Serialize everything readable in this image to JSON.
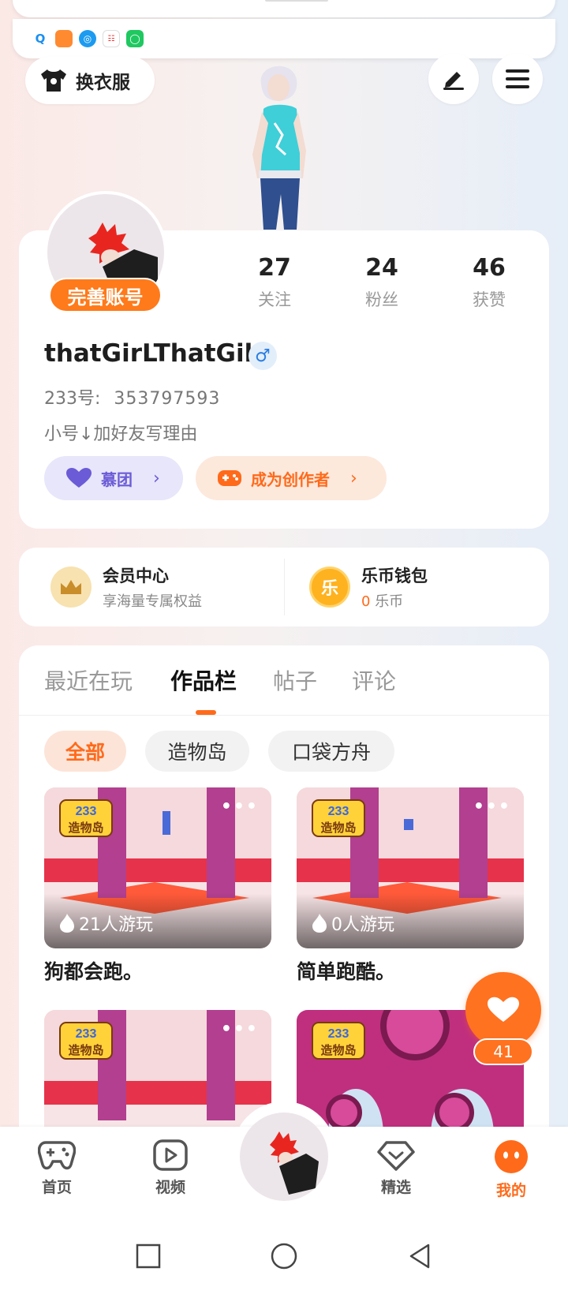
{
  "header": {
    "outfit_label": "换衣服",
    "edit_icon": "pen-icon",
    "menu_icon": "hamburger-menu-icon"
  },
  "profile": {
    "complete_badge": "完善账号",
    "stats": [
      {
        "num": "27",
        "label": "关注"
      },
      {
        "num": "24",
        "label": "粉丝"
      },
      {
        "num": "46",
        "label": "获赞"
      }
    ],
    "username": "thatGirLThatGih",
    "gender_symbol": "♂",
    "uid_label": "233号:",
    "uid_value": "353797593",
    "bio": "小号↓加好友写理由",
    "fan_group_label": "慕团",
    "creator_label": "成为创作者"
  },
  "member": {
    "vip_title": "会员中心",
    "vip_sub": "享海量专属权益",
    "wallet_title": "乐币钱包",
    "wallet_amount": "0",
    "wallet_unit": "乐币",
    "wallet_icon_char": "乐"
  },
  "works": {
    "tabs": [
      "最近在玩",
      "作品栏",
      "帖子",
      "评论"
    ],
    "active_tab": "作品栏",
    "chips": [
      "全部",
      "造物岛",
      "口袋方舟"
    ],
    "active_chip": "全部",
    "games": [
      {
        "title": "狗都会跑。",
        "plays": "21人游玩",
        "logo_top": "233",
        "logo_bottom": "造物岛"
      },
      {
        "title": "简单跑酷。",
        "plays": "0人游玩",
        "logo_top": "233",
        "logo_bottom": "造物岛"
      },
      {
        "title": "",
        "plays": "",
        "logo_top": "233",
        "logo_bottom": "造物岛"
      },
      {
        "title": "",
        "plays": "",
        "logo_top": "233",
        "logo_bottom": "造物岛"
      }
    ],
    "menu_dots": "•••"
  },
  "like_fab": {
    "count": "41"
  },
  "bottom_nav": [
    {
      "label": "首页",
      "icon": "gamepad-icon"
    },
    {
      "label": "视频",
      "icon": "video-play-icon"
    },
    {
      "label": "精选",
      "icon": "heart-diamond-icon"
    },
    {
      "label": "我的",
      "icon": "me-face-icon"
    }
  ],
  "colors": {
    "accent": "#ff6a1a",
    "fan_purple": "#6b5bd6",
    "gender_blue": "#2a7de1"
  }
}
